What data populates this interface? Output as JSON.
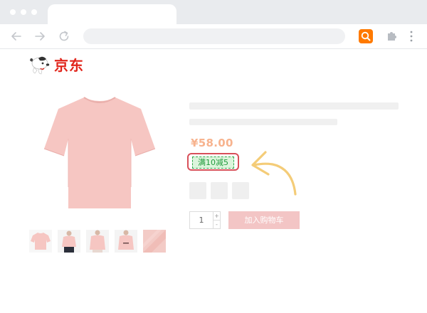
{
  "browser": {
    "back_icon": "arrow-left-icon",
    "forward_icon": "arrow-right-icon",
    "reload_icon": "reload-icon",
    "extension_icon": "search-icon",
    "extensions_icon": "puzzle-icon",
    "menu_icon": "kebab-menu-icon",
    "accent": "#ff7a00"
  },
  "store": {
    "logo_text": "京东",
    "brand_color": "#e1251b"
  },
  "product": {
    "price": "¥58.00",
    "price_color": "#f7b38e",
    "promo_label": "满10减5",
    "quantity": "1",
    "qty_plus": "+",
    "qty_minus": "-",
    "add_to_cart_label": "加入购物车",
    "shirt_color": "#f6c6c2"
  }
}
